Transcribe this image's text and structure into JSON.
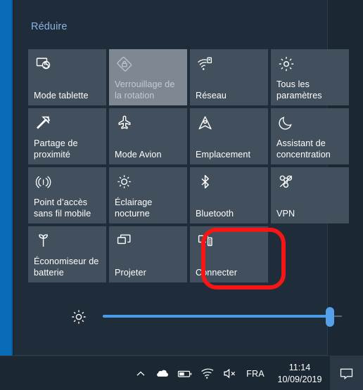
{
  "panel": {
    "collapse_label": "Réduire"
  },
  "tiles": [
    {
      "label": "Mode tablette",
      "icon": "tablet-mode-icon",
      "state": "normal"
    },
    {
      "label": "Verrouillage de la rotation",
      "icon": "rotation-lock-icon",
      "state": "disabled"
    },
    {
      "label": "Réseau",
      "icon": "network-icon",
      "state": "normal"
    },
    {
      "label": "Tous les paramètres",
      "icon": "settings-gear-icon",
      "state": "normal"
    },
    {
      "label": "Partage de proximité",
      "icon": "nearby-share-icon",
      "state": "normal"
    },
    {
      "label": "Mode Avion",
      "icon": "airplane-icon",
      "state": "normal"
    },
    {
      "label": "Emplacement",
      "icon": "location-icon",
      "state": "normal"
    },
    {
      "label": "Assistant de concentration",
      "icon": "focus-assist-moon-icon",
      "state": "normal"
    },
    {
      "label": "Point d’accès sans fil mobile",
      "icon": "mobile-hotspot-icon",
      "state": "normal"
    },
    {
      "label": "Éclairage nocturne",
      "icon": "night-light-icon",
      "state": "normal"
    },
    {
      "label": "Bluetooth",
      "icon": "bluetooth-icon",
      "state": "normal"
    },
    {
      "label": "VPN",
      "icon": "vpn-icon",
      "state": "normal"
    },
    {
      "label": "Économiseur de batterie",
      "icon": "battery-saver-leaf-icon",
      "state": "normal"
    },
    {
      "label": "Projeter",
      "icon": "project-screens-icon",
      "state": "normal"
    },
    {
      "label": "Connecter",
      "icon": "connect-display-icon",
      "state": "normal"
    }
  ],
  "brightness": {
    "icon": "brightness-sun-icon",
    "value_percent": 95,
    "fill_color": "#4a9ae8",
    "thumb_color": "#56a0ea"
  },
  "annotation": {
    "target_tile_label": "Connecter",
    "shape": "rounded-rectangle",
    "color": "#f51616"
  },
  "taskbar": {
    "tray": {
      "chevron": "show-hidden-icons-icon",
      "onedrive": "onedrive-cloud-icon",
      "battery": "battery-icon",
      "network": "wifi-icon",
      "volume": "volume-muted-icon",
      "language": "FRA",
      "time": "11:14",
      "date": "10/09/2019",
      "action_center": "action-center-icon"
    }
  },
  "colors": {
    "panel_background": "#1f2c3a",
    "tile_background": "#42505d",
    "tile_disabled_background": "#7d8893",
    "desktop_accent": "#0a6cb8",
    "link": "#8cb4e2"
  }
}
